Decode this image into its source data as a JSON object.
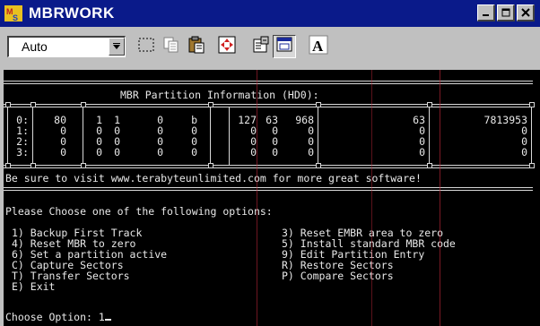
{
  "window": {
    "title": "MBRWORK",
    "colors": {
      "titlebar": "#0a1a8a",
      "console_bg": "#000000",
      "console_fg": "#e8e8e8",
      "chrome": "#c0c0c0"
    }
  },
  "toolbar": {
    "font_select_value": "Auto"
  },
  "console": {
    "table_title": "MBR Partition Information (HD0):",
    "rows": [
      [
        "0:",
        "80",
        "1",
        "1",
        "0",
        "b",
        "127",
        "63",
        "968",
        "63",
        "7813953"
      ],
      [
        "1:",
        "0",
        "0",
        "0",
        "0",
        "0",
        "0",
        "0",
        "0",
        "0",
        "0"
      ],
      [
        "2:",
        "0",
        "0",
        "0",
        "0",
        "0",
        "0",
        "0",
        "0",
        "0",
        "0"
      ],
      [
        "3:",
        "0",
        "0",
        "0",
        "0",
        "0",
        "0",
        "0",
        "0",
        "0",
        "0"
      ]
    ],
    "promo": "Be sure to visit www.terabyteunlimited.com for more great software!",
    "prompt_header": "Please Choose one of the following options:",
    "options_left": [
      "1) Backup First Track",
      "4) Reset MBR to zero",
      "6) Set a partition active",
      "C) Capture Sectors",
      "T) Transfer Sectors",
      "E) Exit"
    ],
    "options_right": [
      "3) Reset EMBR area to zero",
      "5) Install standard MBR code",
      "9) Edit Partition Entry",
      "R) Restore Sectors",
      "P) Compare Sectors"
    ],
    "choose_label": "Choose Option: 1"
  }
}
